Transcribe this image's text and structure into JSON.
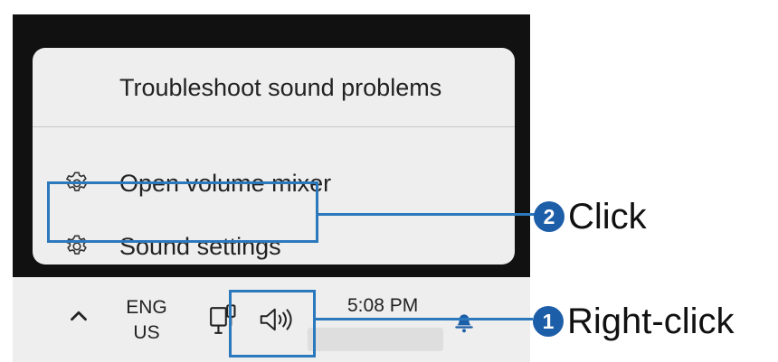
{
  "context_menu": {
    "items": [
      {
        "label": "Troubleshoot sound problems",
        "icon": ""
      },
      {
        "label": "Open volume mixer",
        "icon": "gear-icon"
      },
      {
        "label": "Sound settings",
        "icon": "gear-icon"
      }
    ]
  },
  "taskbar": {
    "chevron_icon": "chevron-up-icon",
    "language": {
      "line1": "ENG",
      "line2": "US"
    },
    "network_icon": "network-icon",
    "volume_icon": "speaker-icon",
    "time": "5:08 PM",
    "notification_icon": "bell-icon"
  },
  "annotations": [
    {
      "number": "2",
      "text": "Click"
    },
    {
      "number": "1",
      "text": "Right-click"
    }
  ],
  "colors": {
    "accent": "#2b78bd",
    "badge": "#1d5ea8",
    "menu_background": "#eeeeee",
    "desktop": "#111111"
  }
}
